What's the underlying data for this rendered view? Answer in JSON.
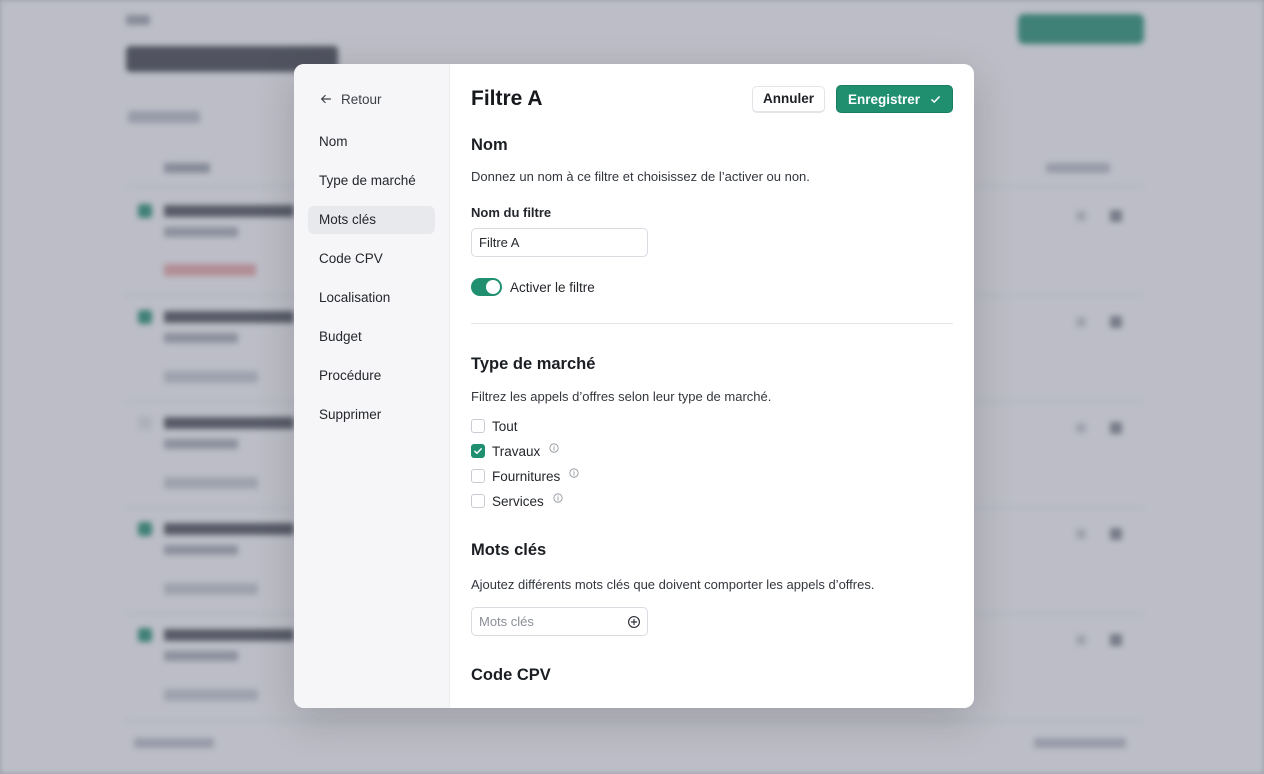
{
  "modal": {
    "back_label": "Retour",
    "nav": [
      {
        "label": "Nom",
        "active": false
      },
      {
        "label": "Type de marché",
        "active": false
      },
      {
        "label": "Mots clés",
        "active": true
      },
      {
        "label": "Code CPV",
        "active": false
      },
      {
        "label": "Localisation",
        "active": false
      },
      {
        "label": "Budget",
        "active": false
      },
      {
        "label": "Procédure",
        "active": false
      },
      {
        "label": "Supprimer",
        "active": false
      }
    ],
    "title": "Filtre A",
    "cancel_label": "Annuler",
    "save_label": "Enregistrer"
  },
  "nom": {
    "title": "Nom",
    "description": "Donnez un nom à ce filtre et choisissez de l’activer ou non.",
    "field_label": "Nom du filtre",
    "field_value": "Filtre A",
    "toggle_label": "Activer le filtre",
    "toggle_on": true
  },
  "type_marche": {
    "title": "Type de marché",
    "description": "Filtrez les appels d’offres selon leur type de marché.",
    "options": [
      {
        "label": "Tout",
        "checked": false,
        "info": false
      },
      {
        "label": "Travaux",
        "checked": true,
        "info": true
      },
      {
        "label": "Fournitures",
        "checked": false,
        "info": true
      },
      {
        "label": "Services",
        "checked": false,
        "info": true
      }
    ]
  },
  "mots_cles": {
    "title": "Mots clés",
    "description": "Ajoutez différents mots clés que doivent comporter les appels d’offres.",
    "placeholder": "Mots clés"
  },
  "code_cpv": {
    "title": "Code CPV"
  },
  "colors": {
    "accent": "#1f8f70",
    "sidebar_bg": "#f6f6f8",
    "active_nav_bg": "#e8e9ed"
  }
}
